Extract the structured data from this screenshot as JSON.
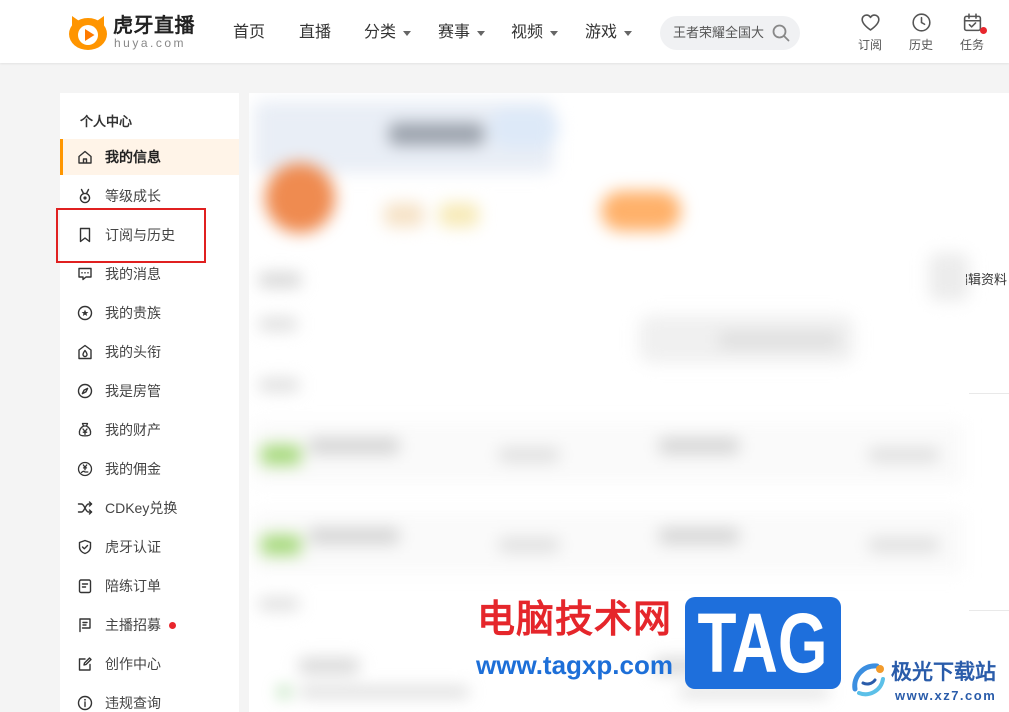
{
  "header": {
    "logo": {
      "title": "虎牙直播",
      "domain": "huya.com",
      "icon": "huya-logo-icon"
    },
    "nav": [
      {
        "label": "首页",
        "has_dropdown": false
      },
      {
        "label": "直播",
        "has_dropdown": false
      },
      {
        "label": "分类",
        "has_dropdown": true
      },
      {
        "label": "赛事",
        "has_dropdown": true
      },
      {
        "label": "视频",
        "has_dropdown": true
      },
      {
        "label": "游戏",
        "has_dropdown": true
      }
    ],
    "search": {
      "placeholder": "王者荣耀全国大",
      "icon": "search-icon"
    },
    "actions": [
      {
        "label": "订阅",
        "icon": "heart-icon",
        "has_badge": false
      },
      {
        "label": "历史",
        "icon": "clock-icon",
        "has_badge": false
      },
      {
        "label": "任务",
        "icon": "calendar-icon",
        "has_badge": true
      }
    ]
  },
  "sidebar": {
    "title": "个人中心",
    "items": [
      {
        "label": "我的信息",
        "icon": "home-icon",
        "active": true
      },
      {
        "label": "等级成长",
        "icon": "medal-icon"
      },
      {
        "label": "订阅与历史",
        "icon": "bookmark-icon",
        "highlighted": true
      },
      {
        "label": "我的消息",
        "icon": "message-icon"
      },
      {
        "label": "我的贵族",
        "icon": "star-circle-icon"
      },
      {
        "label": "我的头衔",
        "icon": "title-badge-icon"
      },
      {
        "label": "我是房管",
        "icon": "compass-icon"
      },
      {
        "label": "我的财产",
        "icon": "money-bag-icon"
      },
      {
        "label": "我的佣金",
        "icon": "commission-icon"
      },
      {
        "label": "CDKey兑换",
        "icon": "shuffle-icon"
      },
      {
        "label": "虎牙认证",
        "icon": "shield-check-icon"
      },
      {
        "label": "陪练订单",
        "icon": "order-list-icon"
      },
      {
        "label": "主播招募",
        "icon": "flag-icon",
        "has_badge": true
      },
      {
        "label": "创作中心",
        "icon": "edit-icon"
      },
      {
        "label": "违规查询",
        "icon": "info-icon"
      }
    ]
  },
  "main": {
    "edit_profile_label": "编辑资料"
  },
  "watermark": {
    "site_name": "电脑技术网",
    "site_url": "www.tagxp.com",
    "badge_text": "TAG",
    "partner_name": "极光下载站",
    "partner_url": "www.xz7.com"
  },
  "colors": {
    "accent": "#ff9600",
    "active_background": "#fff4e8",
    "highlight_box": "#e02020",
    "badge_dot": "#e8262d",
    "watermark_red": "#e5262b",
    "watermark_blue": "#1e6fdc"
  }
}
